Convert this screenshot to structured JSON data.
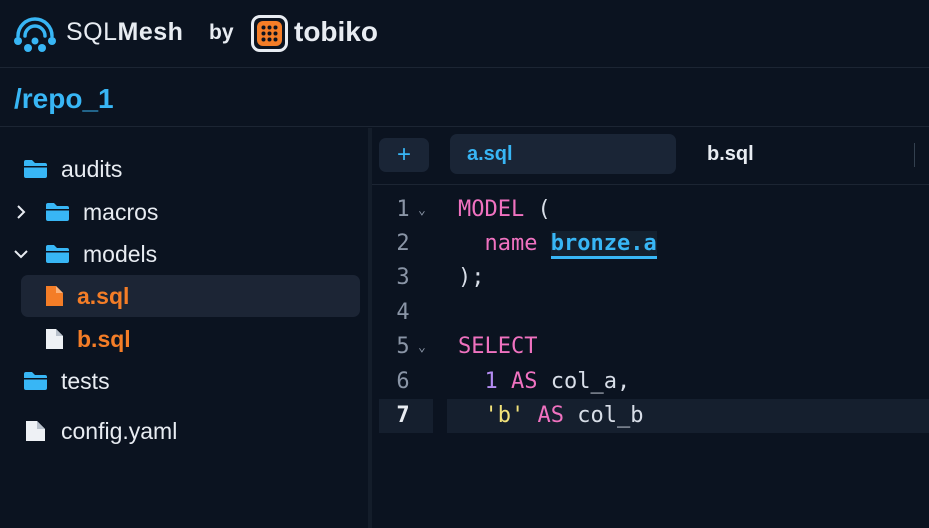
{
  "brand": {
    "sql": "SQL",
    "mesh": "Mesh",
    "by": "by",
    "tobiko": "tobiko"
  },
  "path": "/repo_1",
  "colors": {
    "accent": "#38b6f5",
    "orange": "#f47d27",
    "keyword": "#f072c0",
    "number": "#b48cf2",
    "string": "#f2e27a",
    "background": "#0b1320"
  },
  "tree": [
    {
      "label": "audits",
      "icon": "folder-icon",
      "expanded": false
    },
    {
      "label": "macros",
      "icon": "folder-icon",
      "chevron": "chevron-right-icon"
    },
    {
      "label": "models",
      "icon": "folder-icon",
      "chevron": "chevron-down-icon"
    },
    {
      "label": "a.sql",
      "icon": "file-icon",
      "selected": true
    },
    {
      "label": "b.sql",
      "icon": "file-icon"
    },
    {
      "label": "tests",
      "icon": "folder-icon"
    },
    {
      "label": "config.yaml",
      "icon": "file-icon"
    }
  ],
  "tabs": {
    "add": "+",
    "items": [
      {
        "label": "a.sql",
        "active": true
      },
      {
        "label": "b.sql",
        "active": false
      }
    ]
  },
  "editor": {
    "active_line": 7,
    "lines": [
      {
        "num": "1",
        "fold": "⌄"
      },
      {
        "num": "2"
      },
      {
        "num": "3"
      },
      {
        "num": "4"
      },
      {
        "num": "5",
        "fold": "⌄"
      },
      {
        "num": "6"
      },
      {
        "num": "7"
      }
    ],
    "tokens": {
      "model_kw": "MODEL",
      "paren_open": " (",
      "name_kw": "name",
      "ref": "bronze.a",
      "close": ");",
      "select_kw": "SELECT",
      "one": "1",
      "as1": "AS",
      "col_a": " col_a,",
      "b_str": "'b'",
      "as2": "AS",
      "col_b": " col_b"
    }
  }
}
